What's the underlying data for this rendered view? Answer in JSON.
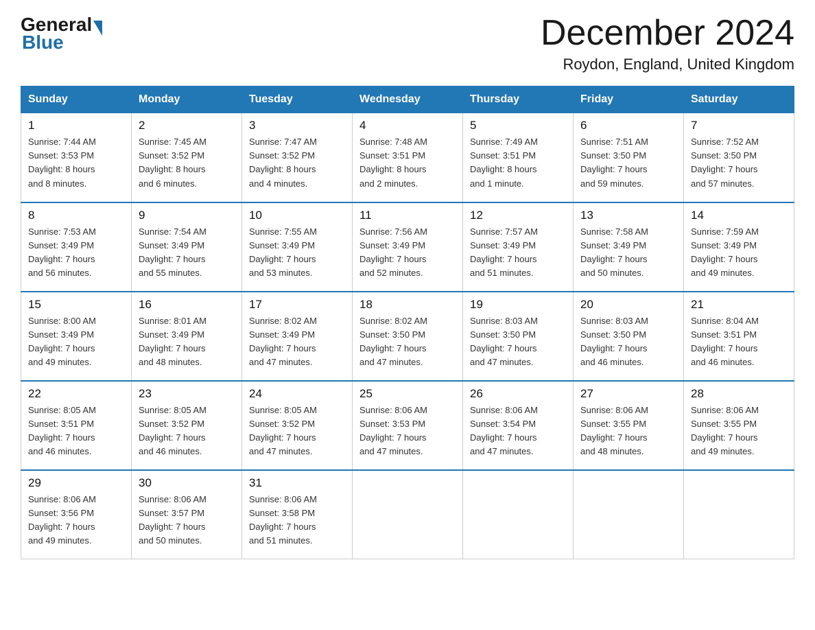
{
  "header": {
    "logo_general": "General",
    "logo_blue": "Blue",
    "title": "December 2024",
    "subtitle": "Roydon, England, United Kingdom"
  },
  "columns": [
    "Sunday",
    "Monday",
    "Tuesday",
    "Wednesday",
    "Thursday",
    "Friday",
    "Saturday"
  ],
  "weeks": [
    [
      {
        "day": "1",
        "info": "Sunrise: 7:44 AM\nSunset: 3:53 PM\nDaylight: 8 hours\nand 8 minutes."
      },
      {
        "day": "2",
        "info": "Sunrise: 7:45 AM\nSunset: 3:52 PM\nDaylight: 8 hours\nand 6 minutes."
      },
      {
        "day": "3",
        "info": "Sunrise: 7:47 AM\nSunset: 3:52 PM\nDaylight: 8 hours\nand 4 minutes."
      },
      {
        "day": "4",
        "info": "Sunrise: 7:48 AM\nSunset: 3:51 PM\nDaylight: 8 hours\nand 2 minutes."
      },
      {
        "day": "5",
        "info": "Sunrise: 7:49 AM\nSunset: 3:51 PM\nDaylight: 8 hours\nand 1 minute."
      },
      {
        "day": "6",
        "info": "Sunrise: 7:51 AM\nSunset: 3:50 PM\nDaylight: 7 hours\nand 59 minutes."
      },
      {
        "day": "7",
        "info": "Sunrise: 7:52 AM\nSunset: 3:50 PM\nDaylight: 7 hours\nand 57 minutes."
      }
    ],
    [
      {
        "day": "8",
        "info": "Sunrise: 7:53 AM\nSunset: 3:49 PM\nDaylight: 7 hours\nand 56 minutes."
      },
      {
        "day": "9",
        "info": "Sunrise: 7:54 AM\nSunset: 3:49 PM\nDaylight: 7 hours\nand 55 minutes."
      },
      {
        "day": "10",
        "info": "Sunrise: 7:55 AM\nSunset: 3:49 PM\nDaylight: 7 hours\nand 53 minutes."
      },
      {
        "day": "11",
        "info": "Sunrise: 7:56 AM\nSunset: 3:49 PM\nDaylight: 7 hours\nand 52 minutes."
      },
      {
        "day": "12",
        "info": "Sunrise: 7:57 AM\nSunset: 3:49 PM\nDaylight: 7 hours\nand 51 minutes."
      },
      {
        "day": "13",
        "info": "Sunrise: 7:58 AM\nSunset: 3:49 PM\nDaylight: 7 hours\nand 50 minutes."
      },
      {
        "day": "14",
        "info": "Sunrise: 7:59 AM\nSunset: 3:49 PM\nDaylight: 7 hours\nand 49 minutes."
      }
    ],
    [
      {
        "day": "15",
        "info": "Sunrise: 8:00 AM\nSunset: 3:49 PM\nDaylight: 7 hours\nand 49 minutes."
      },
      {
        "day": "16",
        "info": "Sunrise: 8:01 AM\nSunset: 3:49 PM\nDaylight: 7 hours\nand 48 minutes."
      },
      {
        "day": "17",
        "info": "Sunrise: 8:02 AM\nSunset: 3:49 PM\nDaylight: 7 hours\nand 47 minutes."
      },
      {
        "day": "18",
        "info": "Sunrise: 8:02 AM\nSunset: 3:50 PM\nDaylight: 7 hours\nand 47 minutes."
      },
      {
        "day": "19",
        "info": "Sunrise: 8:03 AM\nSunset: 3:50 PM\nDaylight: 7 hours\nand 47 minutes."
      },
      {
        "day": "20",
        "info": "Sunrise: 8:03 AM\nSunset: 3:50 PM\nDaylight: 7 hours\nand 46 minutes."
      },
      {
        "day": "21",
        "info": "Sunrise: 8:04 AM\nSunset: 3:51 PM\nDaylight: 7 hours\nand 46 minutes."
      }
    ],
    [
      {
        "day": "22",
        "info": "Sunrise: 8:05 AM\nSunset: 3:51 PM\nDaylight: 7 hours\nand 46 minutes."
      },
      {
        "day": "23",
        "info": "Sunrise: 8:05 AM\nSunset: 3:52 PM\nDaylight: 7 hours\nand 46 minutes."
      },
      {
        "day": "24",
        "info": "Sunrise: 8:05 AM\nSunset: 3:52 PM\nDaylight: 7 hours\nand 47 minutes."
      },
      {
        "day": "25",
        "info": "Sunrise: 8:06 AM\nSunset: 3:53 PM\nDaylight: 7 hours\nand 47 minutes."
      },
      {
        "day": "26",
        "info": "Sunrise: 8:06 AM\nSunset: 3:54 PM\nDaylight: 7 hours\nand 47 minutes."
      },
      {
        "day": "27",
        "info": "Sunrise: 8:06 AM\nSunset: 3:55 PM\nDaylight: 7 hours\nand 48 minutes."
      },
      {
        "day": "28",
        "info": "Sunrise: 8:06 AM\nSunset: 3:55 PM\nDaylight: 7 hours\nand 49 minutes."
      }
    ],
    [
      {
        "day": "29",
        "info": "Sunrise: 8:06 AM\nSunset: 3:56 PM\nDaylight: 7 hours\nand 49 minutes."
      },
      {
        "day": "30",
        "info": "Sunrise: 8:06 AM\nSunset: 3:57 PM\nDaylight: 7 hours\nand 50 minutes."
      },
      {
        "day": "31",
        "info": "Sunrise: 8:06 AM\nSunset: 3:58 PM\nDaylight: 7 hours\nand 51 minutes."
      },
      {
        "day": "",
        "info": ""
      },
      {
        "day": "",
        "info": ""
      },
      {
        "day": "",
        "info": ""
      },
      {
        "day": "",
        "info": ""
      }
    ]
  ]
}
